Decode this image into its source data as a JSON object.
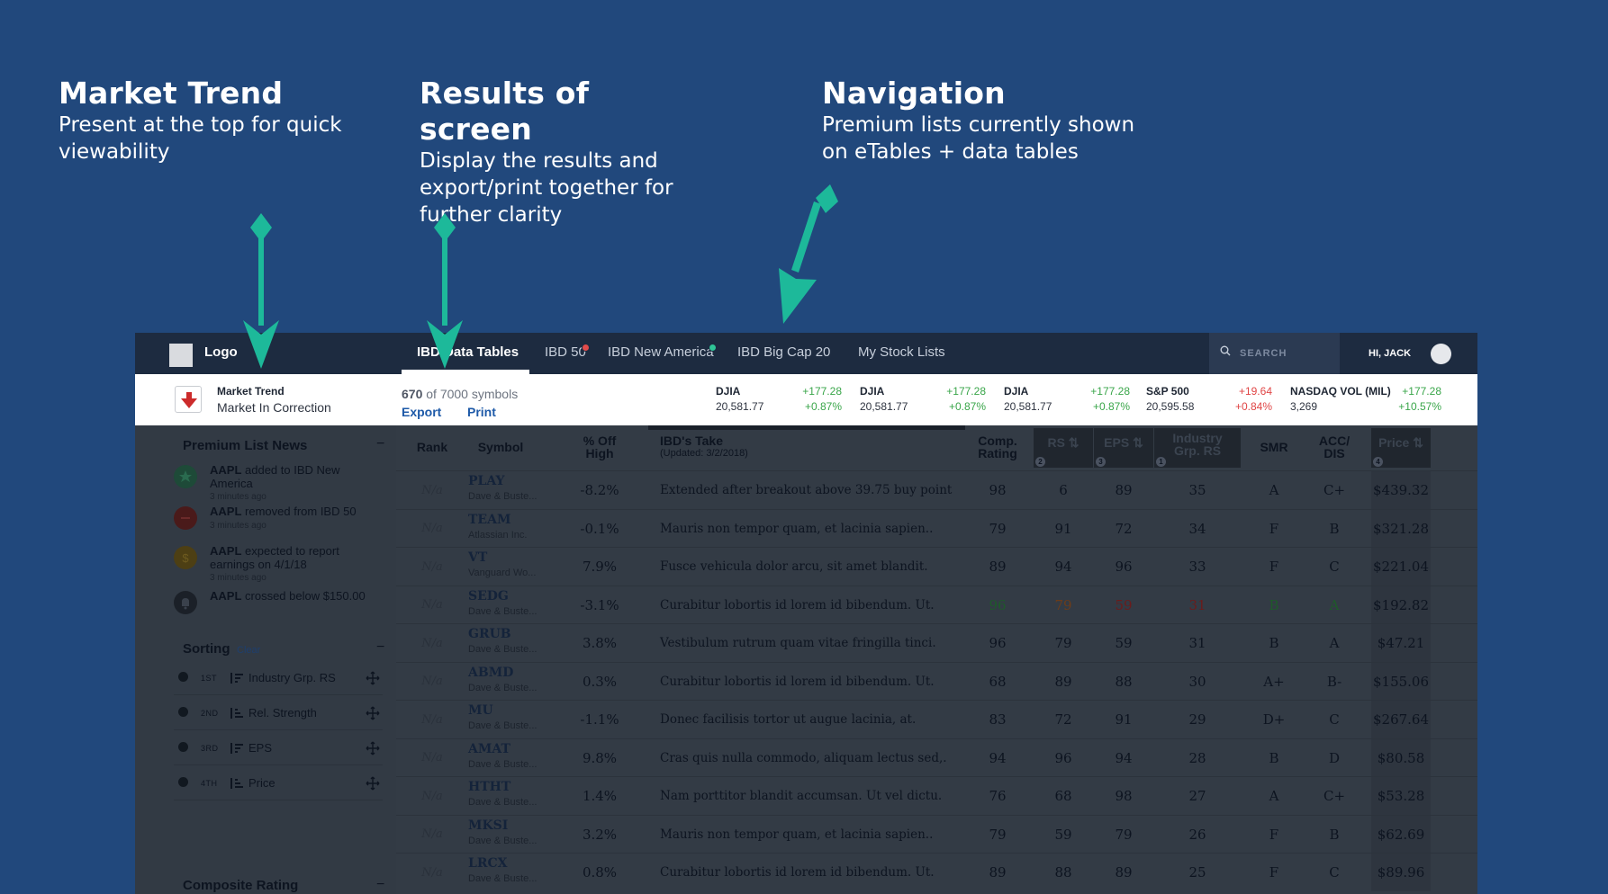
{
  "annotations": [
    {
      "title": "Market Trend",
      "text": "Present at the top for quick viewability"
    },
    {
      "title": "Results of screen",
      "text": "Display the results and export/print together for further clarity"
    },
    {
      "title": "Navigation",
      "text": "Premium lists currently shown on eTables + data tables"
    }
  ],
  "colors": {
    "background": "#21487c",
    "arrow": "#1db99a",
    "nav": "#1d2b40"
  },
  "nav": {
    "logo": "Logo",
    "tabs": [
      {
        "label": "IBD Data Tables",
        "active": true
      },
      {
        "label": "IBD 50",
        "badge": "red"
      },
      {
        "label": "IBD New America",
        "badge": "green"
      },
      {
        "label": "IBD Big Cap 20"
      },
      {
        "label": "My Stock Lists"
      }
    ],
    "search_placeholder": "SEARCH",
    "user_greeting": "HI, JACK"
  },
  "market": {
    "trend_title": "Market Trend",
    "trend_status": "Market In Correction",
    "count": "670",
    "of_label": "of 7000 symbols",
    "export_label": "Export",
    "print_label": "Print",
    "indices": [
      {
        "name": "DJIA",
        "value": "20,581.77",
        "change": "+177.28",
        "pct": "+0.87%",
        "dir": "up"
      },
      {
        "name": "DJIA",
        "value": "20,581.77",
        "change": "+177.28",
        "pct": "+0.87%",
        "dir": "up"
      },
      {
        "name": "DJIA",
        "value": "20,581.77",
        "change": "+177.28",
        "pct": "+0.87%",
        "dir": "up"
      },
      {
        "name": "S&P 500",
        "value": "20,595.58",
        "change": "+19.64",
        "pct": "+0.84%",
        "dir": "down"
      },
      {
        "name": "NASDAQ VOL (MIL)",
        "value": "3,269",
        "change": "+177.28",
        "pct": "+10.57%",
        "dir": "up"
      }
    ]
  },
  "sidebar": {
    "news_heading": "Premium List News",
    "news": [
      {
        "symbol": "AAPL",
        "text": "added to IBD New America",
        "time": "3 minutes ago",
        "icon": "star-icon"
      },
      {
        "symbol": "AAPL",
        "text": "removed from IBD 50",
        "time": "3 minutes ago",
        "icon": "minus-icon"
      },
      {
        "symbol": "AAPL",
        "text": "expected to report earnings on 4/1/18",
        "time": "3 minutes ago",
        "icon": "dollar-icon"
      },
      {
        "symbol": "AAPL",
        "text": "crossed below $150.00",
        "time": "",
        "icon": "bell-icon"
      }
    ],
    "sorting_heading": "Sorting",
    "clear_label": "Clear",
    "sorts": [
      {
        "order": "1ST",
        "label": "Industry Grp. RS"
      },
      {
        "order": "2ND",
        "label": "Rel. Strength"
      },
      {
        "order": "3RD",
        "label": "EPS"
      },
      {
        "order": "4TH",
        "label": "Price"
      }
    ],
    "composite_heading": "Composite Rating"
  },
  "table": {
    "headers": {
      "rank": "Rank",
      "symbol": "Symbol",
      "off_high_1": "% Off",
      "off_high_2": "High",
      "take": "IBD's Take",
      "take_sub": "(Updated: 3/2/2018)",
      "comp_1": "Comp.",
      "comp_2": "Rating",
      "rs": "RS",
      "eps": "EPS",
      "ind_1": "Industry",
      "ind_2": "Grp. RS",
      "smr": "SMR",
      "acc_1": "ACC/",
      "acc_2": "DIS",
      "price": "Price"
    },
    "sort_badges": [
      "2",
      "3",
      "1",
      "4"
    ],
    "rows": [
      {
        "rank": "N/a",
        "symbol": "PLAY",
        "company": "Dave & Buste...",
        "off": "-8.2%",
        "take": "Extended after breakout above 39.75 buy point",
        "comp": "98",
        "rs": "6",
        "eps": "89",
        "ind": "35",
        "smr": "A",
        "acc": "C+",
        "price": "$439.32"
      },
      {
        "rank": "N/a",
        "symbol": "TEAM",
        "company": "Atlassian Inc.",
        "off": "-0.1%",
        "take": "Mauris non tempor quam, et lacinia sapien..",
        "comp": "79",
        "rs": "91",
        "eps": "72",
        "ind": "34",
        "smr": "F",
        "acc": "B",
        "price": "$321.28"
      },
      {
        "rank": "N/a",
        "symbol": "VT",
        "company": "Vanguard Wo...",
        "off": "7.9%",
        "take": "Fusce vehicula dolor arcu, sit amet blandit.",
        "comp": "89",
        "rs": "94",
        "eps": "96",
        "ind": "33",
        "smr": "F",
        "acc": "C",
        "price": "$221.04"
      },
      {
        "rank": "N/a",
        "symbol": "SEDG",
        "company": "Dave & Buste...",
        "off": "-3.1%",
        "take": "Curabitur lobortis id lorem id bibendum. Ut.",
        "comp": "96",
        "rs": "79",
        "eps": "59",
        "ind": "31",
        "smr": "B",
        "acc": "A",
        "price": "$192.82",
        "highlight": true
      },
      {
        "rank": "N/a",
        "symbol": "GRUB",
        "company": "Dave & Buste...",
        "off": "3.8%",
        "take": "Vestibulum rutrum quam vitae fringilla tinci.",
        "comp": "96",
        "rs": "79",
        "eps": "59",
        "ind": "31",
        "smr": "B",
        "acc": "A",
        "price": "$47.21"
      },
      {
        "rank": "N/a",
        "symbol": "ABMD",
        "company": "Dave & Buste...",
        "off": "0.3%",
        "take": "Curabitur lobortis id lorem id bibendum. Ut.",
        "comp": "68",
        "rs": "89",
        "eps": "88",
        "ind": "30",
        "smr": "A+",
        "acc": "B-",
        "price": "$155.06"
      },
      {
        "rank": "N/a",
        "symbol": "MU",
        "company": "Dave & Buste...",
        "off": "-1.1%",
        "take": "Donec facilisis tortor ut augue lacinia, at.",
        "comp": "83",
        "rs": "72",
        "eps": "91",
        "ind": "29",
        "smr": "D+",
        "acc": "C",
        "price": "$267.64"
      },
      {
        "rank": "N/a",
        "symbol": "AMAT",
        "company": "Dave & Buste...",
        "off": "9.8%",
        "take": "Cras quis nulla commodo, aliquam lectus sed,.",
        "comp": "94",
        "rs": "96",
        "eps": "94",
        "ind": "28",
        "smr": "B",
        "acc": "D",
        "price": "$80.58"
      },
      {
        "rank": "N/a",
        "symbol": "HTHT",
        "company": "Dave & Buste...",
        "off": "1.4%",
        "take": "Nam porttitor blandit accumsan. Ut vel dictu.",
        "comp": "76",
        "rs": "68",
        "eps": "98",
        "ind": "27",
        "smr": "A",
        "acc": "C+",
        "price": "$53.28"
      },
      {
        "rank": "N/a",
        "symbol": "MKSI",
        "company": "Dave & Buste...",
        "off": "3.2%",
        "take": "Mauris non tempor quam, et lacinia sapien..",
        "comp": "79",
        "rs": "59",
        "eps": "79",
        "ind": "26",
        "smr": "F",
        "acc": "B",
        "price": "$62.69"
      },
      {
        "rank": "N/a",
        "symbol": "LRCX",
        "company": "Dave & Buste...",
        "off": "0.8%",
        "take": "Curabitur lobortis id lorem id bibendum. Ut.",
        "comp": "89",
        "rs": "88",
        "eps": "89",
        "ind": "25",
        "smr": "F",
        "acc": "C",
        "price": "$89.96"
      }
    ]
  }
}
